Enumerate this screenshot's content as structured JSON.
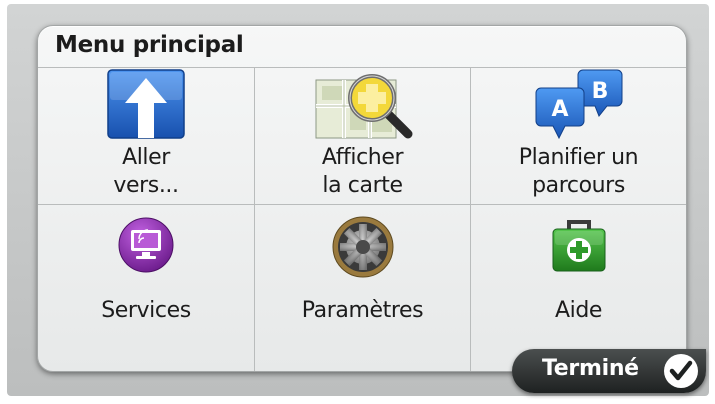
{
  "menu": {
    "title": "Menu principal",
    "items": [
      {
        "label": "Aller\nvers...",
        "icon": "arrow-up-icon"
      },
      {
        "label": "Afficher\nla carte",
        "icon": "map-magnifier-icon"
      },
      {
        "label": "Planifier un\nparcours",
        "icon": "route-ab-icon"
      },
      {
        "label": "Services",
        "icon": "monitor-icon"
      },
      {
        "label": "Paramètres",
        "icon": "gear-icon"
      },
      {
        "label": "Aide",
        "icon": "first-aid-kit-icon"
      }
    ]
  },
  "footer": {
    "done_label": "Terminé",
    "done_icon": "checkmark-icon"
  },
  "colors": {
    "accent_blue": "#1f64c8",
    "services_purple": "#8a2da8",
    "help_green": "#2e9a2a",
    "map_yellow": "#f3d83a"
  }
}
